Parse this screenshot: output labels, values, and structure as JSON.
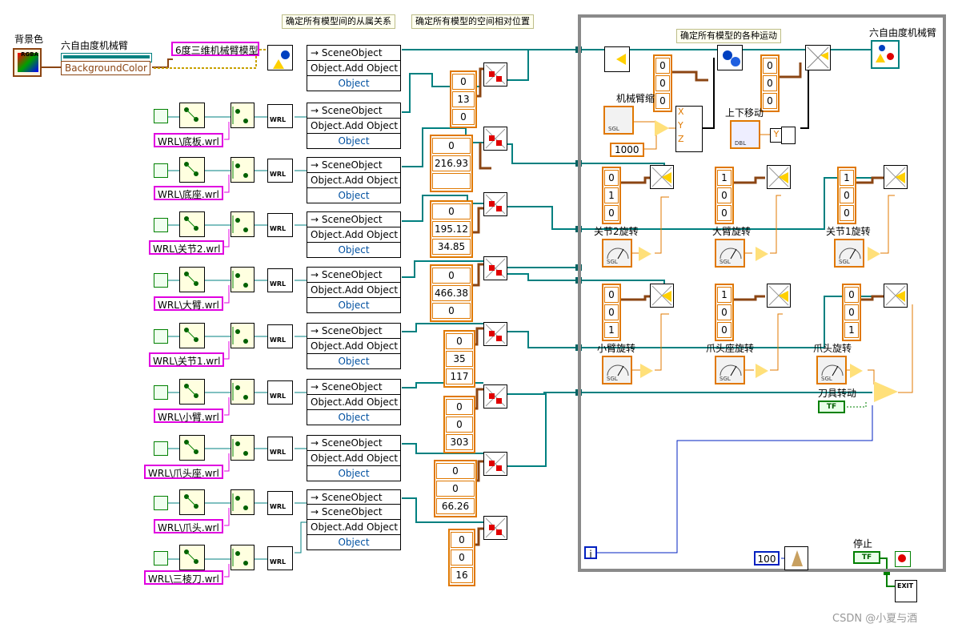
{
  "title_labels": {
    "background_color": "背景色",
    "robot_ref": "六自由度机械臂",
    "bgcolor_property": "BackgroundColor",
    "scene_model": "6度三维机械臂模型",
    "robot_output": "六自由度机械臂"
  },
  "notes": {
    "hierarchy": "确定所有模型间的从属关系",
    "relative_position": "确定所有模型的空间相对位置",
    "motions": "确定所有模型的各种运动"
  },
  "scene_node": {
    "row1": "→ SceneObject",
    "row2": "Object.Add Object",
    "row3": "Object"
  },
  "wrl_files": [
    "WRL\\底板.wrl",
    "WRL\\底座.wrl",
    "WRL\\关节2.wrl",
    "WRL\\大臂.wrl",
    "WRL\\关节1.wrl",
    "WRL\\小臂.wrl",
    "WRL\\爪头座.wrl",
    "WRL\\爪头.wrl",
    "WRL\\三棱刀.wrl"
  ],
  "translation_arrays": [
    [
      "0",
      "13",
      "0"
    ],
    [
      "0",
      "216.93",
      ""
    ],
    [
      "0",
      "195.12",
      "34.85"
    ],
    [
      "0",
      "466.38",
      "0"
    ],
    [
      "0",
      "35",
      "117"
    ],
    [
      "0",
      "0",
      "303"
    ],
    [
      "0",
      "0",
      "66.26"
    ],
    [
      "0",
      "0",
      "16"
    ]
  ],
  "loop": {
    "arm_extend_label": "机械臂缩",
    "move_updown_label": "上下移动",
    "const_1000": "1000",
    "arr_a": [
      "0",
      "0",
      "0"
    ],
    "arr_b": [
      "0",
      "0",
      "0"
    ],
    "axis_labels": [
      "X",
      "Y",
      "Z"
    ],
    "y_label": "Y",
    "rotations": [
      {
        "label": "关节2旋转",
        "axis": [
          "0",
          "1",
          "0"
        ]
      },
      {
        "label": "大臂旋转",
        "axis": [
          "1",
          "0",
          "0"
        ]
      },
      {
        "label": "关节1旋转",
        "axis": [
          "1",
          "0",
          "0"
        ]
      },
      {
        "label": "小臂旋转",
        "axis": [
          "0",
          "0",
          "1"
        ]
      },
      {
        "label": "爪头座旋转",
        "axis": [
          "1",
          "0",
          "0"
        ]
      },
      {
        "label": "爪头旋转",
        "axis": [
          "0",
          "0",
          "1"
        ]
      }
    ],
    "tool_rotate_label": "刀具转动",
    "iteration": "i",
    "wait_ms": "100",
    "stop_label": "停止",
    "tf_text": "TF",
    "dial_text": "SGL",
    "dbl_text": "DBL",
    "exit_text": "EXIT",
    "rgba_text": "RGBA",
    "wrl_text": "WRL"
  },
  "watermark": "CSDN @小夏与酒",
  "colors": {
    "wire_teal": "#008080",
    "wire_orange": "#e07800",
    "wire_brown": "#8b4513",
    "path_magenta": "#e000e0",
    "frame_gray": "#8a8a8a"
  }
}
